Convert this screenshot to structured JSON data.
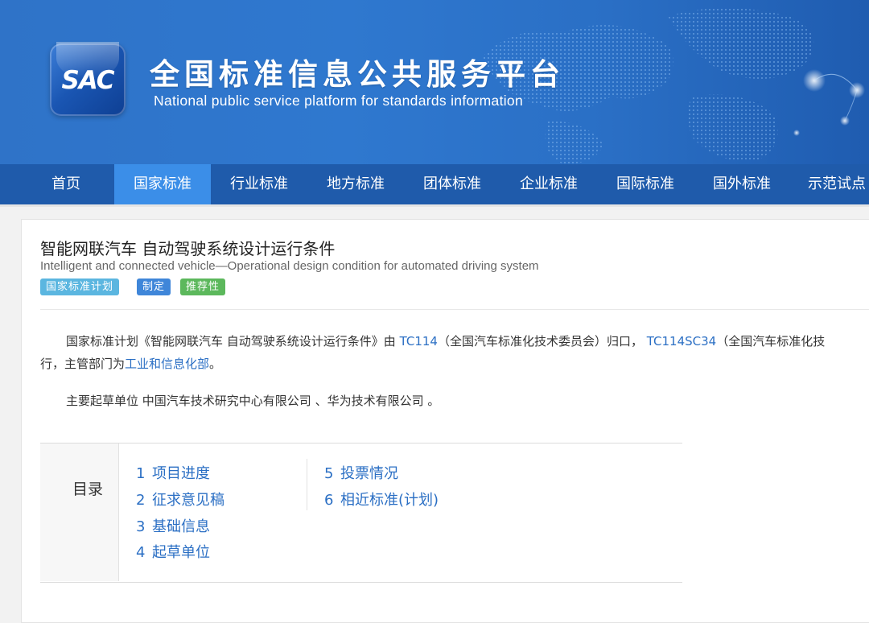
{
  "header": {
    "logo_text": "SAC",
    "title": "全国标准信息公共服务平台",
    "subtitle": "National public service platform  for standards information"
  },
  "nav": {
    "items": [
      {
        "label": "首页",
        "active": false
      },
      {
        "label": "国家标准",
        "active": true
      },
      {
        "label": "行业标准",
        "active": false
      },
      {
        "label": "地方标准",
        "active": false
      },
      {
        "label": "团体标准",
        "active": false
      },
      {
        "label": "企业标准",
        "active": false
      },
      {
        "label": "国际标准",
        "active": false
      },
      {
        "label": "国外标准",
        "active": false
      },
      {
        "label": "示范试点",
        "active": false
      }
    ]
  },
  "standard": {
    "title": "智能网联汽车 自动驾驶系统设计运行条件",
    "title_en": "Intelligent and connected vehicle—Operational design condition for automated driving system",
    "tags": [
      {
        "label": "国家标准计划",
        "color": "#5bb6e0"
      },
      {
        "label": "制定",
        "color": "#3f86d9"
      },
      {
        "label": "推荐性",
        "color": "#5cb85c"
      }
    ],
    "desc": {
      "p1_prefix": "国家标准计划《智能网联汽车 自动驾驶系统设计运行条件》由",
      "tc1": "TC114",
      "tc1_name": "（全国汽车标准化技术委员会）归口，",
      "tc2": "TC114SC34",
      "tc2_name": "（全国汽车标准化技",
      "p1_line2_prefix": "行，主管部门为",
      "dept": "工业和信息化部",
      "p1_line2_suffix": "。",
      "p2_label": "主要起草单位",
      "p2_orgs": "中国汽车技术研究中心有限公司 、华为技术有限公司 。"
    }
  },
  "toc": {
    "label": "目录",
    "items": [
      {
        "num": "1",
        "label": "项目进度"
      },
      {
        "num": "2",
        "label": "征求意见稿"
      },
      {
        "num": "3",
        "label": "基础信息"
      },
      {
        "num": "4",
        "label": "起草单位"
      },
      {
        "num": "5",
        "label": "投票情况"
      },
      {
        "num": "6",
        "label": "相近标准(计划)"
      }
    ]
  }
}
